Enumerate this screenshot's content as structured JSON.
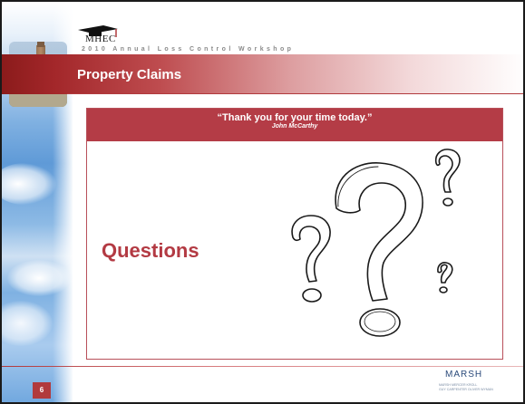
{
  "header": {
    "logo_text": "MHEC",
    "workshop": "2010 Annual Loss Control Workshop"
  },
  "title": "Property Claims",
  "quote": {
    "text": "“Thank you for your time today.”",
    "author": "John McCarthy"
  },
  "main": {
    "questions": "Questions"
  },
  "footer": {
    "page_number": "6",
    "brand": "MARSH",
    "brand_sub_line1": "MARSH  MERCER  KROLL",
    "brand_sub_line2": "GUY CARPENTER  OLIVER WYMAN"
  },
  "colors": {
    "accent": "#b13a3d",
    "band_dark": "#8b1b1b"
  },
  "icons": [
    "graduation-cap-icon",
    "question-marks-graphic"
  ]
}
